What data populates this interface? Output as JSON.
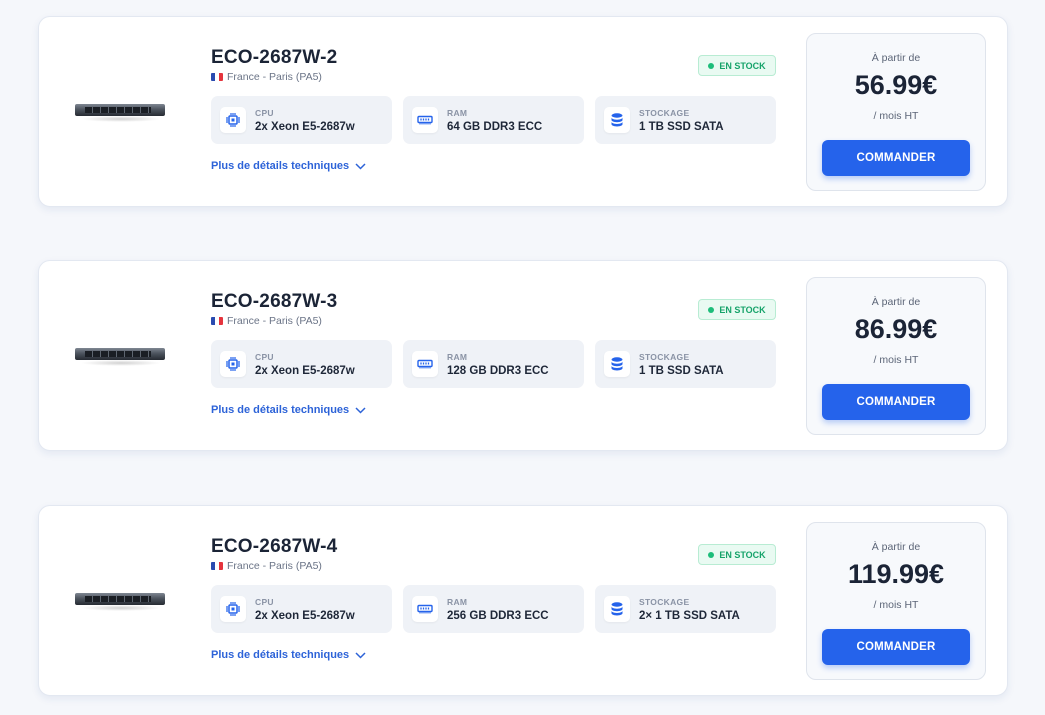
{
  "colors": {
    "accent": "#2563eb",
    "stock_green": "#16a36a",
    "link_blue": "#2d63d8",
    "flag": [
      "#2a4bb0",
      "#ffffff",
      "#e5343d"
    ]
  },
  "servers": [
    {
      "name": "ECO-2687W-2",
      "location": "France - Paris (PA5)",
      "stock": "EN STOCK",
      "specs": {
        "cpu": {
          "label": "CPU",
          "value": "2x Xeon E5-2687w",
          "icon": "cpu-chip-icon"
        },
        "ram": {
          "label": "RAM",
          "value": "64 GB DDR3 ECC",
          "icon": "memory-icon"
        },
        "storage": {
          "label": "STOCKAGE",
          "value": "1 TB SSD SATA",
          "icon": "database-icon"
        }
      },
      "details_link": "Plus de détails techniques",
      "price_prefix": "À partir de",
      "price": "56.99€",
      "period": "/ mois HT",
      "order": "COMMANDER"
    },
    {
      "name": "ECO-2687W-3",
      "location": "France - Paris (PA5)",
      "stock": "EN STOCK",
      "specs": {
        "cpu": {
          "label": "CPU",
          "value": "2x Xeon E5-2687w",
          "icon": "cpu-chip-icon"
        },
        "ram": {
          "label": "RAM",
          "value": "128 GB DDR3 ECC",
          "icon": "memory-icon"
        },
        "storage": {
          "label": "STOCKAGE",
          "value": "1 TB SSD SATA",
          "icon": "database-icon"
        }
      },
      "details_link": "Plus de détails techniques",
      "price_prefix": "À partir de",
      "price": "86.99€",
      "period": "/ mois HT",
      "order": "COMMANDER"
    },
    {
      "name": "ECO-2687W-4",
      "location": "France - Paris (PA5)",
      "stock": "EN STOCK",
      "specs": {
        "cpu": {
          "label": "CPU",
          "value": "2x Xeon E5-2687w",
          "icon": "cpu-chip-icon"
        },
        "ram": {
          "label": "RAM",
          "value": "256 GB DDR3 ECC",
          "icon": "memory-icon"
        },
        "storage": {
          "label": "STOCKAGE",
          "value": "2× 1 TB SSD SATA",
          "icon": "database-icon"
        }
      },
      "details_link": "Plus de détails techniques",
      "price_prefix": "À partir de",
      "price": "119.99€",
      "period": "/ mois HT",
      "order": "COMMANDER"
    }
  ]
}
